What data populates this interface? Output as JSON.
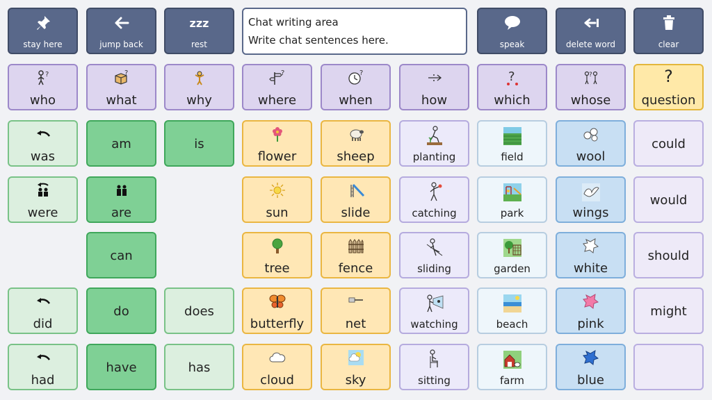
{
  "toolbar": {
    "stay_here": "stay here",
    "jump_back": "jump back",
    "rest": "rest",
    "speak": "speak",
    "delete_word": "delete word",
    "clear": "clear",
    "rest_symbol": "zzz"
  },
  "chat": {
    "line1": "Chat writing area",
    "line2": "Write chat sentences here."
  },
  "questions": {
    "who": "who",
    "what": "what",
    "why": "why",
    "where": "where",
    "when": "when",
    "how": "how",
    "which": "which",
    "whose": "whose",
    "question": "question",
    "question_mark": "?"
  },
  "verbs": {
    "was": "was",
    "am": "am",
    "is": "is",
    "were": "were",
    "are": "are",
    "can": "can",
    "did": "did",
    "do": "do",
    "does": "does",
    "had": "had",
    "have": "have",
    "has": "has"
  },
  "nouns": {
    "flower": "flower",
    "sheep": "sheep",
    "sun": "sun",
    "slide": "slide",
    "tree": "tree",
    "fence": "fence",
    "butterfly": "butterfly",
    "net": "net",
    "cloud": "cloud",
    "sky": "sky"
  },
  "actions": {
    "planting": "planting",
    "catching": "catching",
    "sliding": "sliding",
    "watching": "watching",
    "sitting": "sitting"
  },
  "places": {
    "field": "field",
    "park": "park",
    "garden": "garden",
    "beach": "beach",
    "farm": "farm"
  },
  "descriptors": {
    "wool": "wool",
    "wings": "wings",
    "white": "white",
    "pink": "pink",
    "blue": "blue"
  },
  "modals": {
    "could": "could",
    "would": "would",
    "should": "should",
    "might": "might"
  },
  "colors": {
    "toolbar": "#59688a",
    "question_purple": "#ddd5ef",
    "verb_green": "#7fd095",
    "noun_yellow": "#ffe7b5",
    "describe_blue": "#c8dff3"
  }
}
